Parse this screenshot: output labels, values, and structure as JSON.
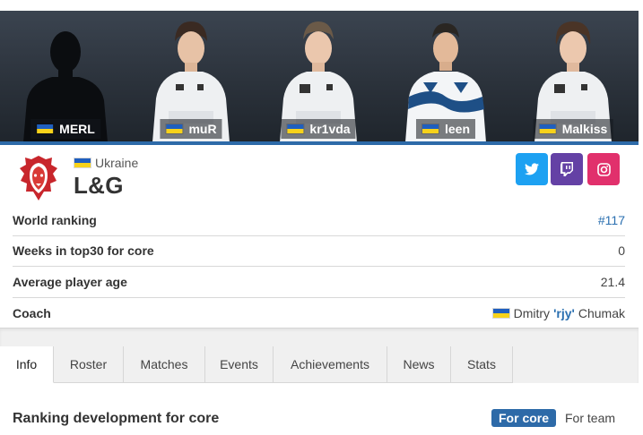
{
  "players": [
    {
      "nick": "MERL",
      "flag": "ukraine",
      "photo": "silhouette"
    },
    {
      "nick": "muR",
      "flag": "ukraine",
      "photo": "hoodie-white"
    },
    {
      "nick": "kr1vda",
      "flag": "ukraine",
      "photo": "hoodie-white"
    },
    {
      "nick": "leen",
      "flag": "ukraine",
      "photo": "jersey-white-blue"
    },
    {
      "nick": "Malkiss",
      "flag": "ukraine",
      "photo": "hoodie-white"
    }
  ],
  "team": {
    "country": "Ukraine",
    "name": "L&G",
    "logo": "lion-head-logo"
  },
  "social": [
    {
      "name": "twitter",
      "icon": "twitter-icon",
      "color": "#1da1f2"
    },
    {
      "name": "twitch",
      "icon": "twitch-icon",
      "color": "#6441a5"
    },
    {
      "name": "instagram",
      "icon": "instagram-icon",
      "color": "#e1306c"
    }
  ],
  "stats": {
    "world_ranking": {
      "label": "World ranking",
      "value": "#117"
    },
    "weeks_top30": {
      "label": "Weeks in top30 for core",
      "value": "0"
    },
    "avg_age": {
      "label": "Average player age",
      "value": "21.4"
    },
    "coach": {
      "label": "Coach",
      "first": "Dmitry",
      "nick": "'rjy'",
      "last": "Chumak"
    }
  },
  "tabs": [
    "Info",
    "Roster",
    "Matches",
    "Events",
    "Achievements",
    "News",
    "Stats"
  ],
  "active_tab": "Info",
  "ranking": {
    "title": "Ranking development for core",
    "toggle_active": "For core",
    "toggle_inactive": "For team"
  },
  "colors": {
    "accent": "#2d6aa8",
    "link": "#2a6fb0",
    "flag_blue": "#1f5fbf",
    "flag_yellow": "#f7d21a"
  }
}
